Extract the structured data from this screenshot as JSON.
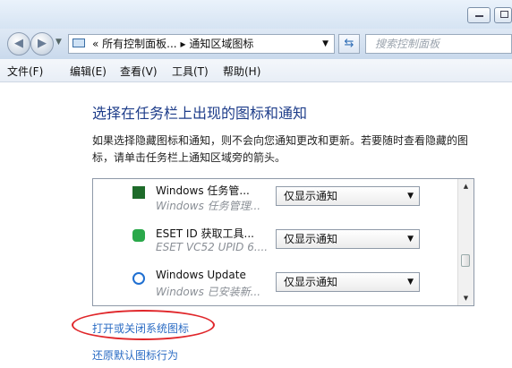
{
  "address_bar": {
    "crumb_prefix": "«",
    "crumb_1": "所有控制面板...",
    "separator": "▸",
    "crumb_2": "通知区域图标",
    "search_placeholder": "搜索控制面板"
  },
  "menu": [
    "文件(F)",
    "编辑(E)",
    "查看(V)",
    "工具(T)",
    "帮助(H)"
  ],
  "content": {
    "heading": "选择在任务栏上出现的图标和通知",
    "description": "如果选择隐藏图标和通知，则不会向您通知更改和更新。若要随时查看隐藏的图标，请单击任务栏上通知区域旁的箭头。"
  },
  "icons_list": [
    {
      "name": "Windows 任务管...",
      "subtitle": "Windows 任务管理...",
      "behavior": "仅显示通知",
      "icon": "task-manager-icon",
      "icon_color": "#1e6b2a"
    },
    {
      "name": "ESET ID 获取工具...",
      "subtitle": "ESET VC52 UPID 6....",
      "behavior": "仅显示通知",
      "icon": "eset-icon",
      "icon_color": "#2aa84a"
    },
    {
      "name": "Windows Update",
      "subtitle": "Windows 已安装新...",
      "behavior": "仅显示通知",
      "icon": "windows-update-icon",
      "icon_color": "#1f6fd1"
    }
  ],
  "links": {
    "system_icons": "打开或关闭系统图标",
    "restore_default": "还原默认图标行为"
  },
  "colors": {
    "heading": "#1e3d8a",
    "link": "#2b6cc4",
    "highlight_ellipse": "#e0262a"
  }
}
